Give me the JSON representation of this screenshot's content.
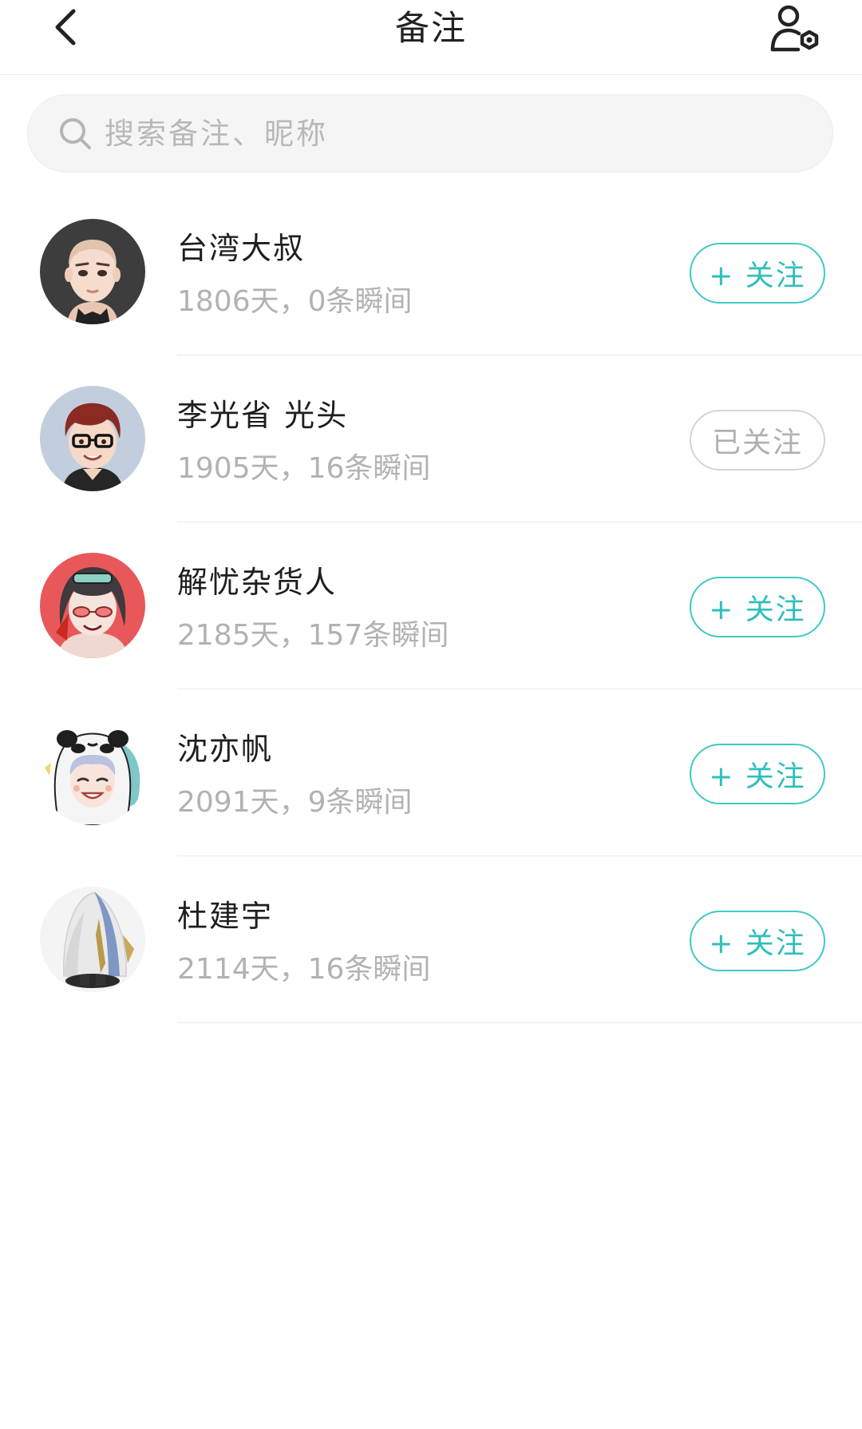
{
  "header": {
    "title": "备注",
    "back_icon": "chevron-left-icon",
    "settings_icon": "user-settings-icon"
  },
  "search": {
    "placeholder": "搜索备注、昵称",
    "icon": "search-icon"
  },
  "colors": {
    "accent": "#3fc9c6",
    "muted": "#b2b2b2"
  },
  "contacts": [
    {
      "name": "台湾大叔",
      "meta": "1806天，0条瞬间",
      "button": "+ 关注",
      "followed": false,
      "avatar": "avatar-bald-man"
    },
    {
      "name": "李光省 光头",
      "meta": "1905天，16条瞬间",
      "button": "已关注",
      "followed": true,
      "avatar": "avatar-glasses-boy"
    },
    {
      "name": "解忧杂货人",
      "meta": "2185天，157条瞬间",
      "button": "+ 关注",
      "followed": false,
      "avatar": "avatar-red-girl"
    },
    {
      "name": "沈亦帆",
      "meta": "2091天，9条瞬间",
      "button": "+ 关注",
      "followed": false,
      "avatar": "avatar-panda-hood"
    },
    {
      "name": "杜建宇",
      "meta": "2114天，16条瞬间",
      "button": "+ 关注",
      "followed": false,
      "avatar": "avatar-fish-costume"
    }
  ]
}
